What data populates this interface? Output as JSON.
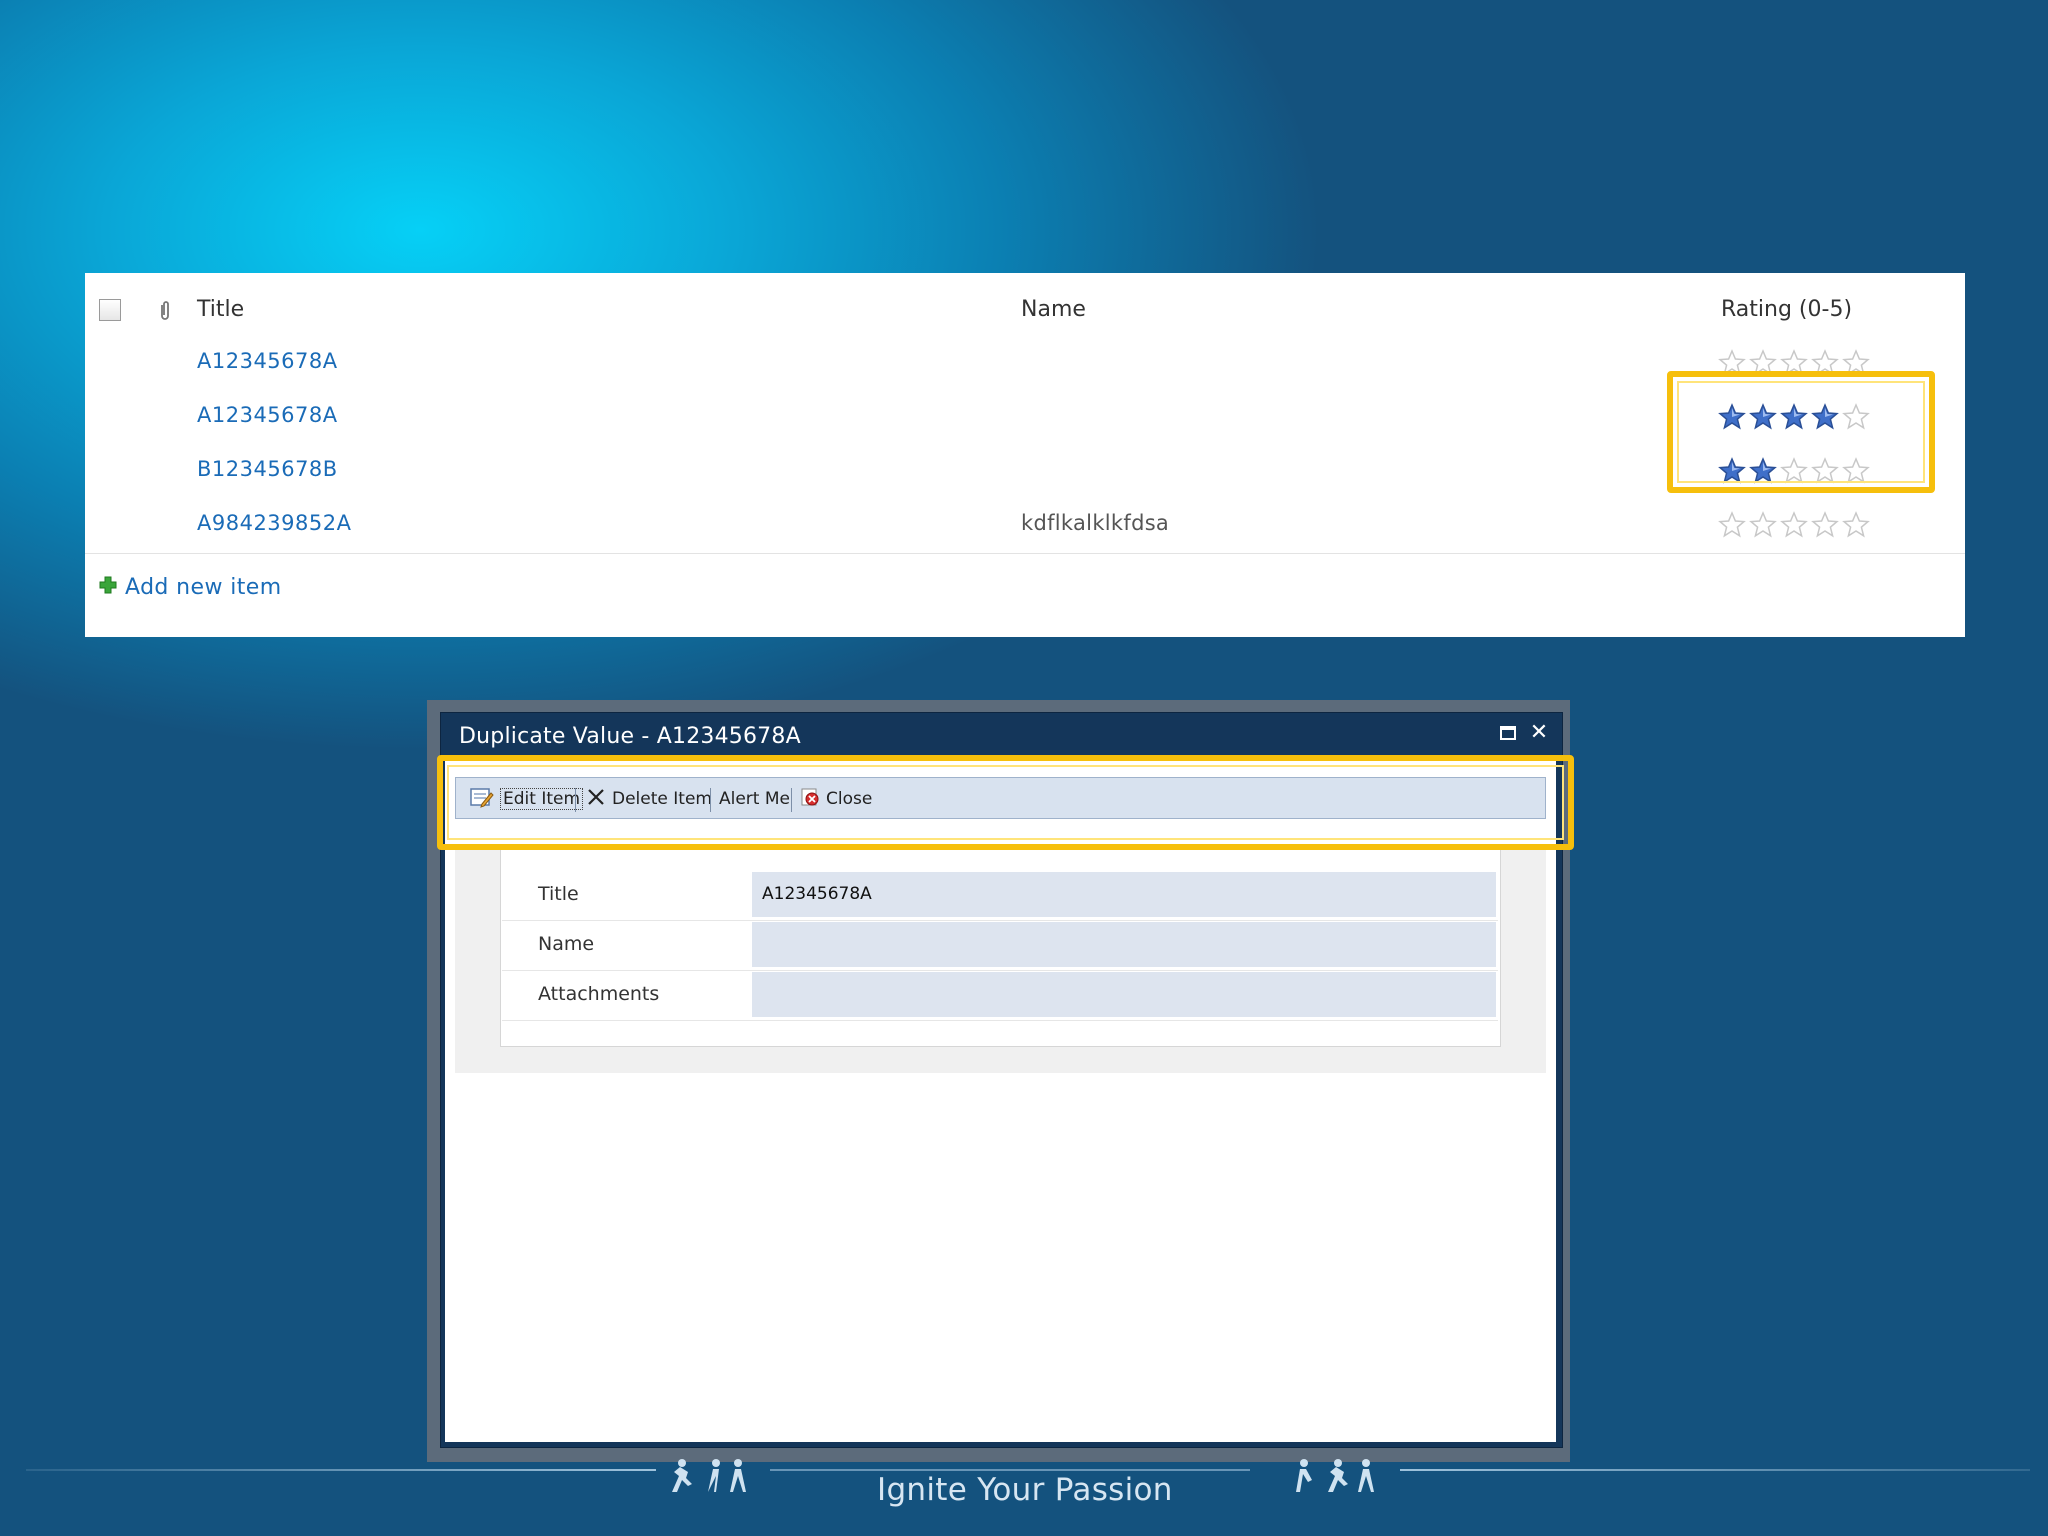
{
  "list": {
    "headers": {
      "title": "Title",
      "name": "Name",
      "rating": "Rating (0-5)"
    },
    "rows": [
      {
        "title": "A12345678A",
        "name": "",
        "rating": 0
      },
      {
        "title": "A12345678A",
        "name": "",
        "rating": 4
      },
      {
        "title": "B12345678B",
        "name": "",
        "rating": 2
      },
      {
        "title": "A984239852A",
        "name": "kdflkalklkfdsa",
        "rating": 0
      }
    ],
    "rating_max": 5,
    "add_new_item": "Add new item"
  },
  "dialog": {
    "title": "Duplicate Value - A12345678A",
    "ribbon": {
      "edit_item": "Edit Item",
      "delete_item": "Delete Item",
      "alert_me": "Alert Me",
      "close": "Close"
    },
    "fields": [
      {
        "label": "Title",
        "value": "A12345678A"
      },
      {
        "label": "Name",
        "value": ""
      },
      {
        "label": "Attachments",
        "value": ""
      }
    ]
  },
  "footer": {
    "tagline": "Ignite Your Passion"
  },
  "colors": {
    "link": "#1a6bb7",
    "highlight": "#f6bf0c",
    "star_filled": "#3f6fc9",
    "star_empty": "#c8c8c8",
    "dialog_title_bar": "#14365a",
    "ribbon_bg": "#d8e2ef"
  }
}
